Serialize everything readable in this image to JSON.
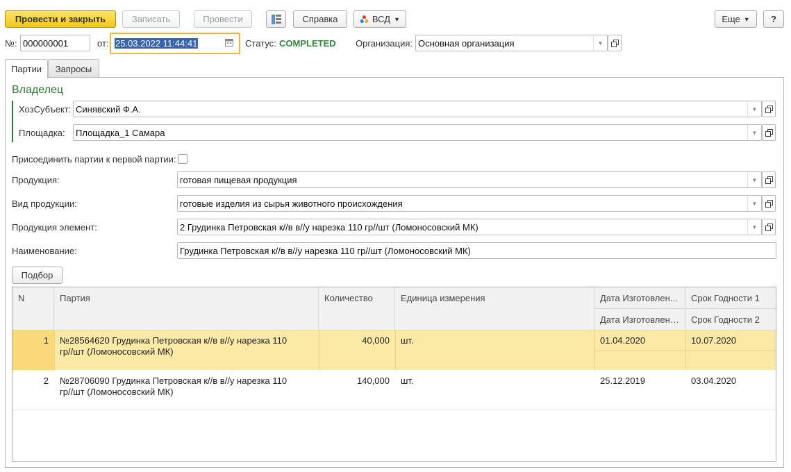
{
  "toolbar": {
    "post_close": "Провести и закрыть",
    "save": "Записать",
    "post": "Провести",
    "help": "Справка",
    "vsd": "ВСД",
    "more": "Еще",
    "question": "?"
  },
  "header": {
    "number_label": "№:",
    "number_value": "000000001",
    "date_label": "от:",
    "date_value": "25.03.2022 11:44:41",
    "status_label": "Статус:",
    "status_value": "COMPLETED",
    "org_label": "Организация:",
    "org_value": "Основная организация"
  },
  "tabs": [
    {
      "label": "Партии"
    },
    {
      "label": "Запросы"
    }
  ],
  "owner": {
    "title": "Владелец",
    "hoz_label": "ХозСубъект:",
    "hoz_value": "Синявский Ф.А.",
    "site_label": "Площадка:",
    "site_value": "Площадка_1 Самара"
  },
  "form": {
    "join_label": "Присоединить партии к первой партии:",
    "product_label": "Продукция:",
    "product_value": "готовая пищевая продукция",
    "kind_label": "Вид продукции:",
    "kind_value": "готовые изделия из сырья животного происхождения",
    "element_label": "Продукция элемент:",
    "element_value": "2 Грудинка Петровская к//в в//у нарезка 110 гр//шт (Ломоносовский МК)",
    "name_label": "Наименование:",
    "name_value": "Грудинка Петровская к//в в//у нарезка 110 гр//шт (Ломоносовский МК)",
    "pick_button": "Подбор"
  },
  "table": {
    "headers": {
      "n": "N",
      "batch": "Партия",
      "qty": "Количество",
      "unit": "Единица измерения",
      "made1": "Дата Изготовлен...",
      "exp1": "Срок Годности 1",
      "made2": "Дата Изготовления",
      "exp2": "Срок Годности 2"
    },
    "rows": [
      {
        "n": "1",
        "batch": "№28564620 Грудинка Петровская к//в в//у нарезка 110 гр//шт (Ломоносовский МК)",
        "qty": "40,000",
        "unit": "шт.",
        "made": "01.04.2020",
        "exp": "10.07.2020"
      },
      {
        "n": "2",
        "batch": "№28706090 Грудинка Петровская к//в в//у нарезка 110 гр//шт (Ломоносовский МК)",
        "qty": "140,000",
        "unit": "шт.",
        "made": "25.12.2019",
        "exp": "03.04.2020"
      }
    ]
  }
}
